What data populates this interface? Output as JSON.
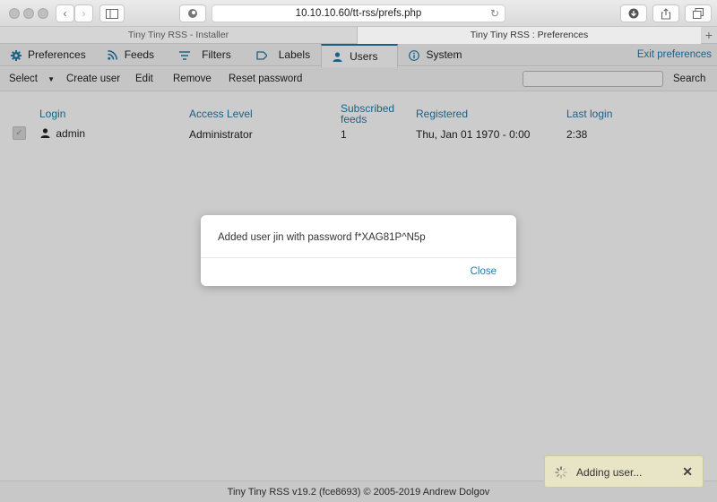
{
  "browser": {
    "url": "10.10.10.60/tt-rss/prefs.php",
    "tabs": [
      {
        "label": "Tiny Tiny RSS - Installer"
      },
      {
        "label": "Tiny Tiny RSS : Preferences"
      }
    ],
    "new_tab": "+"
  },
  "nav": {
    "tabs": [
      {
        "label": "Preferences",
        "icon": "gear-icon"
      },
      {
        "label": "Feeds",
        "icon": "rss-icon"
      },
      {
        "label": "Filters",
        "icon": "filter-icon"
      },
      {
        "label": "Labels",
        "icon": "label-icon"
      },
      {
        "label": "Users",
        "icon": "user-icon"
      },
      {
        "label": "System",
        "icon": "info-icon"
      }
    ],
    "active": "Users",
    "exit_label": "Exit preferences"
  },
  "toolbar": {
    "select_label": "Select",
    "create_label": "Create user",
    "edit_label": "Edit",
    "remove_label": "Remove",
    "reset_label": "Reset password",
    "search_label": "Search",
    "search_value": ""
  },
  "table": {
    "headers": {
      "login": "Login",
      "access": "Access Level",
      "subscribed1": "Subscribed",
      "subscribed2": "feeds",
      "registered": "Registered",
      "last_login": "Last login"
    },
    "rows": [
      {
        "login": "admin",
        "access": "Administrator",
        "feeds": "1",
        "registered": "Thu, Jan 01 1970 - 0:00",
        "last_login": "2:38",
        "checked": true
      }
    ]
  },
  "footer": {
    "text": "Tiny Tiny RSS v19.2 (fce8693) © 2005-2019 Andrew Dolgov"
  },
  "dialog": {
    "message": "Added user jin with password f*XAG81P^N5p",
    "close_label": "Close"
  },
  "notification": {
    "text": "Adding user...",
    "close_symbol": "✕"
  },
  "colors": {
    "accent": "#257aa7",
    "notify_bg": "#e8e4c6"
  }
}
